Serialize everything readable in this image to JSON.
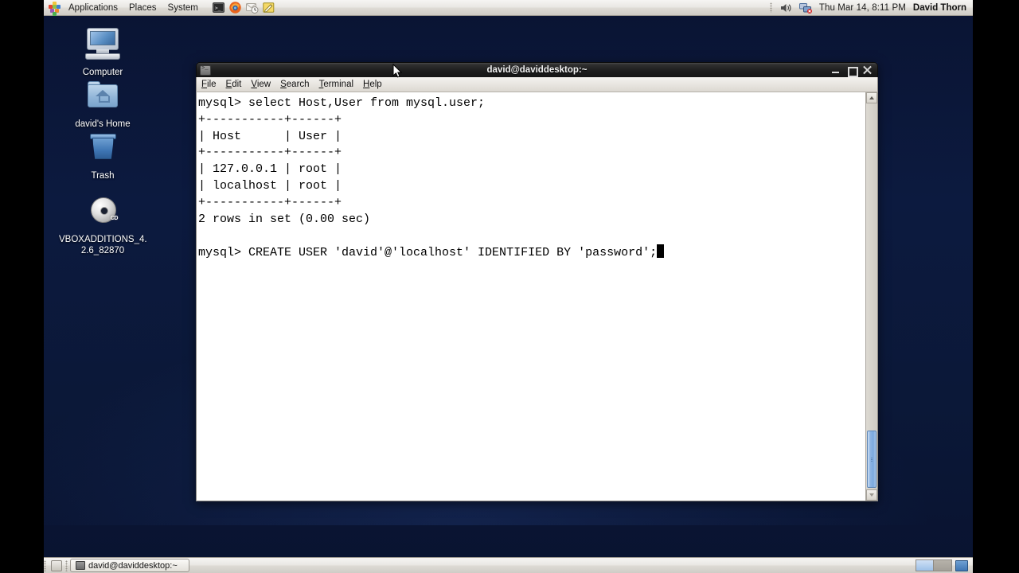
{
  "desktop": {
    "background_color": "#0b1838",
    "icons": [
      {
        "name": "computer",
        "label": "Computer",
        "icon": "computer-icon"
      },
      {
        "name": "home",
        "label": "david's Home",
        "icon": "folder-home-icon"
      },
      {
        "name": "trash",
        "label": "Trash",
        "icon": "trash-icon"
      },
      {
        "name": "cd",
        "label": "VBOXADDITIONS_4.\n2.6_82870",
        "label_line1": "VBOXADDITIONS_4.",
        "label_line2": "2.6_82870",
        "icon": "cd-disc-icon",
        "disc_tag": "CD"
      }
    ]
  },
  "top_panel": {
    "menus": [
      {
        "label": "Applications"
      },
      {
        "label": "Places"
      },
      {
        "label": "System"
      }
    ],
    "launchers": [
      {
        "name": "terminal-launcher",
        "icon": "terminal-icon"
      },
      {
        "name": "firefox-launcher",
        "icon": "firefox-icon"
      },
      {
        "name": "evolution-launcher",
        "icon": "mail-clock-icon"
      },
      {
        "name": "text-editor-launcher",
        "icon": "notepad-pencil-icon"
      }
    ],
    "tray": [
      {
        "name": "volume",
        "icon": "speaker-icon"
      },
      {
        "name": "network",
        "icon": "network-disconnected-icon"
      }
    ],
    "clock": "Thu Mar 14,  8:11 PM",
    "user": "David Thorn"
  },
  "terminal": {
    "title": "david@daviddesktop:~",
    "window_icon": "terminal-icon",
    "menus": [
      {
        "label": "File",
        "accel": "F"
      },
      {
        "label": "Edit",
        "accel": "E"
      },
      {
        "label": "View",
        "accel": "V"
      },
      {
        "label": "Search",
        "accel": "S"
      },
      {
        "label": "Terminal",
        "accel": "T"
      },
      {
        "label": "Help",
        "accel": "H"
      }
    ],
    "window_buttons": {
      "minimize": "minimize-icon",
      "maximize": "maximize-icon",
      "close": "close-icon"
    },
    "content": "mysql> select Host,User from mysql.user;\n+-----------+------+\n| Host      | User |\n+-----------+------+\n| 127.0.0.1 | root |\n| localhost | root |\n+-----------+------+\n2 rows in set (0.00 sec)\n\nmysql> CREATE USER 'david'@'localhost' IDENTIFIED BY 'password';",
    "scrollbar": {
      "up_arrow": "scroll-up-icon",
      "down_arrow": "scroll-down-icon"
    }
  },
  "bottom_panel": {
    "show_desktop": "show-desktop-icon",
    "task_buttons": [
      {
        "label": "david@daviddesktop:~",
        "icon": "terminal-icon"
      }
    ],
    "workspaces": [
      {
        "name": "workspace-1",
        "active": true
      },
      {
        "name": "workspace-2",
        "active": false
      }
    ],
    "trash_applet": "trash-icon"
  }
}
